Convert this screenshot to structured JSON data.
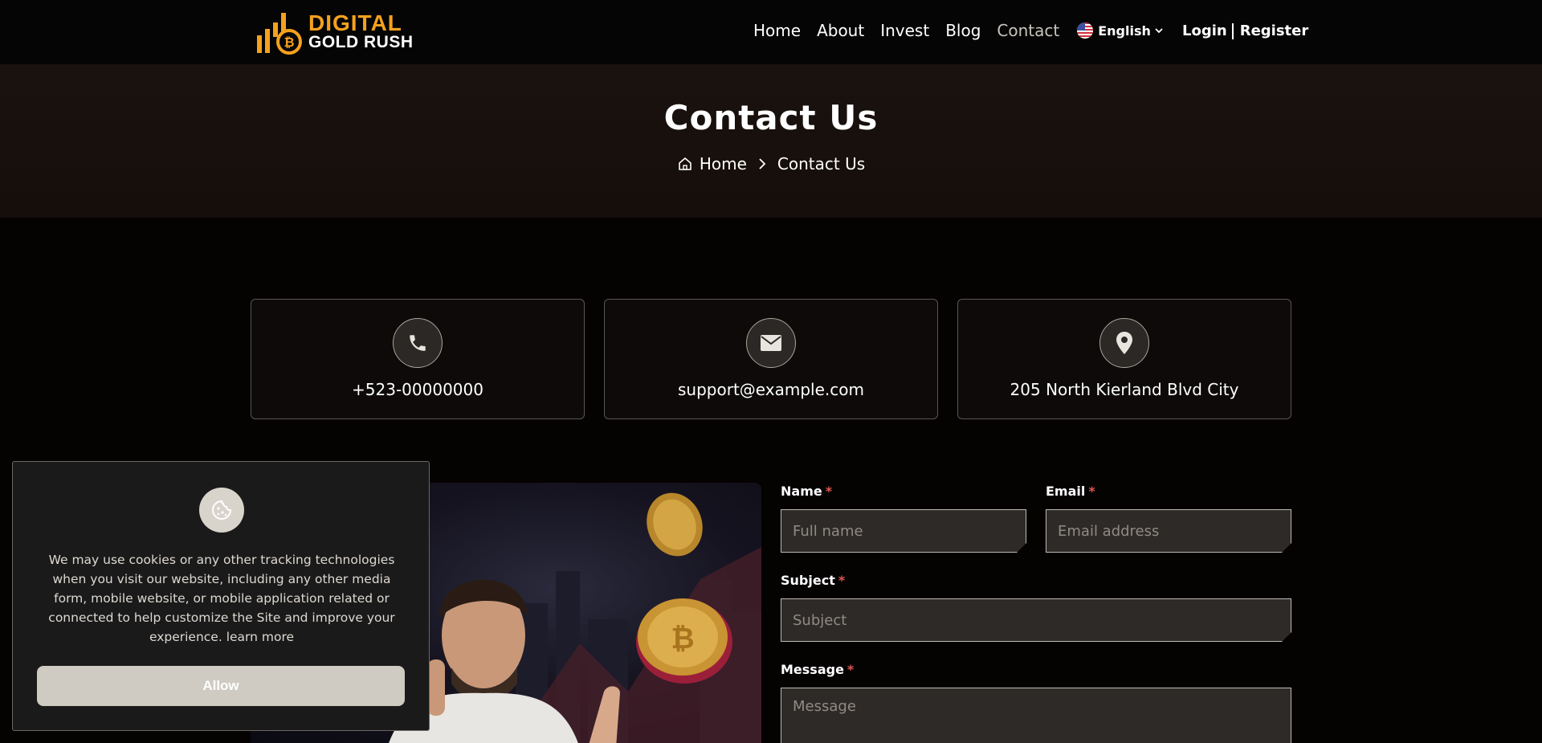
{
  "brand": {
    "line1": "DIGITAL",
    "line2": "GOLD RUSH"
  },
  "nav": {
    "items": [
      {
        "label": "Home"
      },
      {
        "label": "About"
      },
      {
        "label": "Invest"
      },
      {
        "label": "Blog"
      },
      {
        "label": "Contact"
      }
    ],
    "language": "English",
    "login": "Login",
    "register": "Register"
  },
  "banner": {
    "title": "Contact Us",
    "breadcrumb_home": "Home",
    "breadcrumb_current": "Contact Us"
  },
  "contact": {
    "phone": "+523-00000000",
    "email": "support@example.com",
    "address": "205 North Kierland Blvd City"
  },
  "form": {
    "name_label": "Name",
    "name_placeholder": "Full name",
    "email_label": "Email",
    "email_placeholder": "Email address",
    "subject_label": "Subject",
    "subject_placeholder": "Subject",
    "message_label": "Message",
    "message_placeholder": "Message",
    "required_mark": "*"
  },
  "cookie": {
    "text": "We may use cookies or any other tracking technologies when you visit our website, including any other media form, mobile website, or mobile application related or connected to help customize the Site and improve your experience.",
    "link": "learn more",
    "allow": "Allow"
  },
  "colors": {
    "accent": "#f5a11e",
    "background": "#050202",
    "required": "#e0564f"
  }
}
